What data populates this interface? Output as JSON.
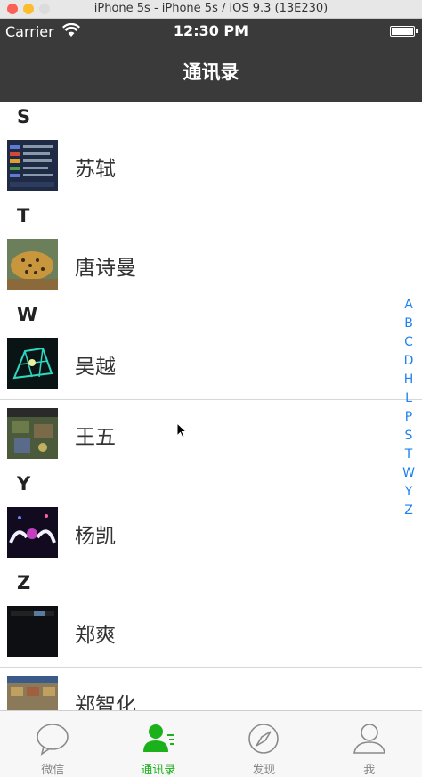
{
  "window": {
    "title": "iPhone 5s - iPhone 5s / iOS 9.3 (13E230)",
    "traffic_light_colors": [
      "#fc5f57",
      "#fdbc2e",
      "#28c840"
    ]
  },
  "status_bar": {
    "carrier": "Carrier",
    "time": "12:30 PM",
    "wifi_icon": "wifi-icon",
    "battery_icon": "battery-icon"
  },
  "nav": {
    "title": "通讯录",
    "background": "#3a3a3a"
  },
  "sections": [
    {
      "letter": "S",
      "contacts": [
        {
          "name": "苏轼",
          "avatar": "avatar-screenshot-blue"
        }
      ]
    },
    {
      "letter": "T",
      "contacts": [
        {
          "name": "唐诗曼",
          "avatar": "avatar-leopard"
        }
      ]
    },
    {
      "letter": "W",
      "contacts": [
        {
          "name": "吴越",
          "avatar": "avatar-neon-grid"
        },
        {
          "name": "王五",
          "avatar": "avatar-game-map"
        }
      ]
    },
    {
      "letter": "Y",
      "contacts": [
        {
          "name": "杨凯",
          "avatar": "avatar-concert"
        }
      ]
    },
    {
      "letter": "Z",
      "contacts": [
        {
          "name": "郑爽",
          "avatar": "avatar-dark"
        },
        {
          "name": "郑智化",
          "avatar": "avatar-game-ui"
        }
      ]
    }
  ],
  "index_letters": [
    "A",
    "B",
    "C",
    "D",
    "H",
    "L",
    "P",
    "S",
    "T",
    "W",
    "Y",
    "Z"
  ],
  "index_color": "#1e82f0",
  "tabs": [
    {
      "label": "微信",
      "icon": "chat-bubble-icon",
      "active": false
    },
    {
      "label": "通讯录",
      "icon": "contacts-icon",
      "active": true
    },
    {
      "label": "发现",
      "icon": "compass-icon",
      "active": false
    },
    {
      "label": "我",
      "icon": "person-icon",
      "active": false
    }
  ],
  "tab_active_color": "#1ab11a"
}
